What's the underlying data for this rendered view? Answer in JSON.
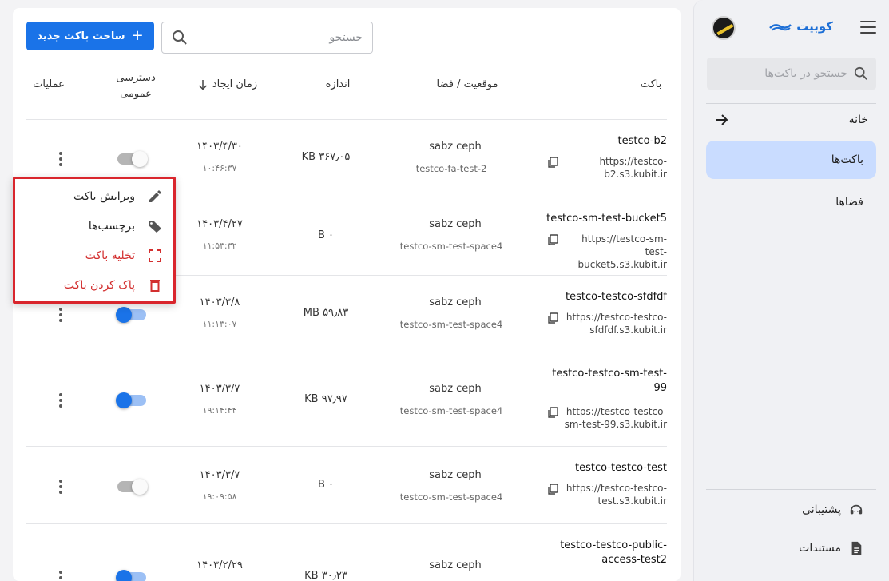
{
  "sidebar": {
    "brand": "کوبیت",
    "search_placeholder": "جستجو در باکت‌ها",
    "home_label": "خانه",
    "items": [
      {
        "label": "باکت‌ها",
        "active": true
      },
      {
        "label": "فضاها",
        "active": false
      }
    ],
    "bottom_items": [
      {
        "label": "پشتیبانی",
        "icon": "support-icon"
      },
      {
        "label": "مستندات",
        "icon": "document-icon"
      }
    ]
  },
  "toolbar": {
    "create_label": "ساخت باکت جدید",
    "search_placeholder": "جستجو"
  },
  "table": {
    "headers": {
      "bucket": "باکت",
      "location": "موقعیت / فضا",
      "size": "اندازه",
      "created": "زمان ایجاد",
      "public_line1": "دسترسی",
      "public_line2": "عمومی",
      "actions": "عملیات"
    },
    "rows": [
      {
        "name": "testco-b2",
        "url": "https://testco-b2.s3.kubit.ir",
        "location": "sabz ceph",
        "space": "testco-fa-test-2",
        "size": "۳۶۷٫۰۵ KB",
        "date": "۱۴۰۳/۴/۳۰",
        "time": "۱۰:۴۶:۳۷",
        "public": false
      },
      {
        "name": "testco-sm-test-bucket5",
        "url": "https://testco-sm-test-bucket5.s3.kubit.ir",
        "location": "sabz ceph",
        "space": "testco-sm-test-space4",
        "size": "۰ B",
        "date": "۱۴۰۳/۴/۲۷",
        "time": "۱۱:۵۳:۳۲",
        "public": false
      },
      {
        "name": "testco-testco-sfdfdf",
        "url": "https://testco-testco-sfdfdf.s3.kubit.ir",
        "location": "sabz ceph",
        "space": "testco-sm-test-space4",
        "size": "۵۹٫۸۳ MB",
        "date": "۱۴۰۳/۳/۸",
        "time": "۱۱:۱۳:۰۷",
        "public": true
      },
      {
        "name": "testco-testco-sm-test-99",
        "url": "https://testco-testco-sm-test-99.s3.kubit.ir",
        "location": "sabz ceph",
        "space": "testco-sm-test-space4",
        "size": "۹۷٫۹۷ KB",
        "date": "۱۴۰۳/۳/۷",
        "time": "۱۹:۱۴:۴۴",
        "public": true
      },
      {
        "name": "testco-testco-test",
        "url": "https://testco-testco-test.s3.kubit.ir",
        "location": "sabz ceph",
        "space": "testco-sm-test-space4",
        "size": "۰ B",
        "date": "۱۴۰۳/۳/۷",
        "time": "۱۹:۰۹:۵۸",
        "public": false
      },
      {
        "name": "testco-testco-public-access-test2",
        "url": "",
        "location": "sabz ceph",
        "space": "",
        "size": "۳۰٫۲۳ KB",
        "date": "۱۴۰۳/۲/۲۹",
        "time": "",
        "public": true
      }
    ]
  },
  "context_menu": {
    "items": [
      {
        "label": "ویرایش باکت",
        "icon": "pencil-icon",
        "danger": false
      },
      {
        "label": "برچسب‌ها",
        "icon": "tag-icon",
        "danger": false
      },
      {
        "label": "تخلیه باکت",
        "icon": "empty-bucket-icon",
        "danger": true
      },
      {
        "label": "پاک کردن باکت",
        "icon": "trash-icon",
        "danger": true
      }
    ]
  },
  "colors": {
    "primary": "#1a73e8",
    "active_nav": "#c9dcff",
    "danger": "#d32f2f",
    "highlight_border": "#d9262d"
  }
}
